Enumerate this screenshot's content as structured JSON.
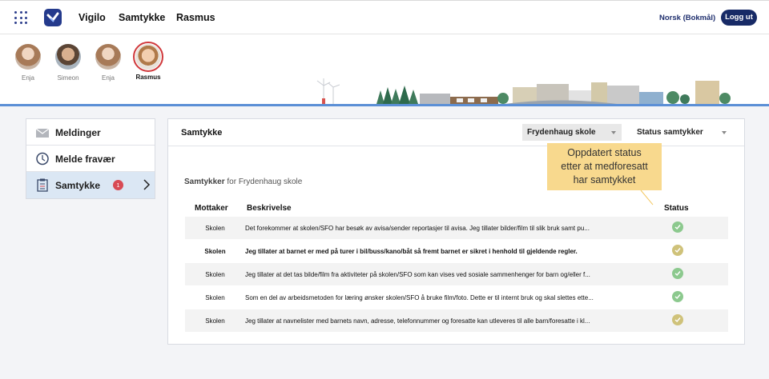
{
  "topbar": {
    "nav": [
      "Vigilo",
      "Samtykke",
      "Rasmus"
    ],
    "language": "Norsk (Bokmål)",
    "logout_label": "Logg ut"
  },
  "children": [
    {
      "name": "Enja",
      "avatar": "girl-avatar"
    },
    {
      "name": "Simeon",
      "avatar": "boy-avatar"
    },
    {
      "name": "Enja",
      "avatar": "girl-avatar"
    },
    {
      "name": "Rasmus",
      "avatar": "child-avatar",
      "selected": true
    }
  ],
  "menu": {
    "items": [
      {
        "label": "Meldinger",
        "icon": "envelope-icon"
      },
      {
        "label": "Melde fravær",
        "icon": "clock-icon"
      },
      {
        "label": "Samtykke",
        "icon": "clipboard-icon",
        "badge": "1",
        "active": true
      }
    ]
  },
  "panel": {
    "title": "Samtykke",
    "school_filter": "Frydenhaug skole",
    "status_filter": "Status samtykker",
    "subtitle_bold": "Samtykker",
    "subtitle_rest": " for Frydenhaug skole",
    "columns": {
      "recipient": "Mottaker",
      "description": "Beskrivelse",
      "status": "Status"
    },
    "rows": [
      {
        "who": "Skolen",
        "desc": "Det forekommer at skolen/SFO har besøk av avisa/sender reportasjer til avisa. Jeg tillater bilder/film til slik bruk samt pu...",
        "status": "green"
      },
      {
        "who": "Skolen",
        "desc": "Jeg tillater at barnet er med på turer i bil/buss/kano/båt så fremt barnet er sikret i henhold til gjeldende regler.",
        "status": "yellow",
        "bold": true
      },
      {
        "who": "Skolen",
        "desc": "Jeg tillater at det tas bilde/film fra aktiviteter på skolen/SFO som kan vises ved sosiale sammenhenger for barn og/eller f...",
        "status": "green"
      },
      {
        "who": "Skolen",
        "desc": "Som en del av arbeidsmetoden for læring ønsker skolen/SFO å bruke film/foto. Dette er til internt bruk og skal slettes ette...",
        "status": "green"
      },
      {
        "who": "Skolen",
        "desc": "Jeg tillater at navnelister med barnets navn, adresse, telefonnummer og foresatte kan utleveres til alle barn/foresatte i kl...",
        "status": "yellow"
      }
    ]
  },
  "annotation": {
    "lines": [
      "Oppdatert status",
      "etter at medforesatt",
      "har samtykket"
    ]
  },
  "colors": {
    "brand": "#172a66",
    "badge": "#d84b55",
    "status_green": "#8cc98e",
    "status_yellow": "#cfc27a",
    "annotation": "#f8d98e"
  }
}
